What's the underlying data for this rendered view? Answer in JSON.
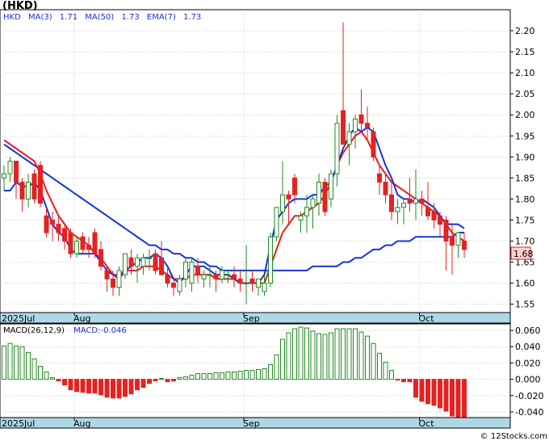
{
  "ticker_label": "(HKD)",
  "legend_main": {
    "symbol": "HKD",
    "ma3": "MA(3)",
    "ma3_value": "1.71",
    "ma50": "MA(50)",
    "ma50_value": "1.73",
    "ema7": "EMA(7)",
    "ema7_value": "1.73"
  },
  "legend_macd": {
    "params": "MACD(26,12,9)",
    "value": "MACD:-0.046"
  },
  "last_price_label": "1.68",
  "credit": "© 12Stocks.com",
  "colors": {
    "up_candle": "#228b22",
    "down_candle": "#e32222",
    "ma_blue": "#1535d6",
    "ema_red": "#ee1c1c",
    "axis_band": "#aed8e6",
    "grid": "#b0b0b0",
    "last_price_bg": "#fbd0d0"
  },
  "chart_data": [
    {
      "type": "candlestick",
      "ylim": [
        1.53,
        2.25
      ],
      "yticks": [
        1.55,
        1.6,
        1.65,
        1.7,
        1.75,
        1.8,
        1.85,
        1.9,
        1.95,
        2.0,
        2.05,
        2.1,
        2.15,
        2.2
      ],
      "xlabels": [
        {
          "text": "2025Jul",
          "i": 0
        },
        {
          "text": "Aug",
          "i": 12
        },
        {
          "text": "Sep",
          "i": 40
        },
        {
          "text": "Oct",
          "i": 69
        }
      ],
      "candles": [
        [
          1.85,
          1.88,
          1.82,
          1.86
        ],
        [
          1.86,
          1.9,
          1.84,
          1.89
        ],
        [
          1.89,
          1.88,
          1.8,
          1.84
        ],
        [
          1.84,
          1.85,
          1.77,
          1.8
        ],
        [
          1.8,
          1.86,
          1.78,
          1.84
        ],
        [
          1.86,
          1.87,
          1.79,
          1.8
        ],
        [
          1.88,
          1.89,
          1.78,
          1.79
        ],
        [
          1.76,
          1.78,
          1.71,
          1.72
        ],
        [
          1.75,
          1.77,
          1.7,
          1.74
        ],
        [
          1.74,
          1.76,
          1.7,
          1.72
        ],
        [
          1.73,
          1.74,
          1.68,
          1.7
        ],
        [
          1.72,
          1.73,
          1.66,
          1.67
        ],
        [
          1.67,
          1.71,
          1.66,
          1.7
        ],
        [
          1.71,
          1.72,
          1.67,
          1.68
        ],
        [
          1.69,
          1.71,
          1.66,
          1.68
        ],
        [
          1.72,
          1.73,
          1.66,
          1.67
        ],
        [
          1.68,
          1.7,
          1.63,
          1.64
        ],
        [
          1.63,
          1.64,
          1.58,
          1.61
        ],
        [
          1.61,
          1.63,
          1.57,
          1.59
        ],
        [
          1.59,
          1.64,
          1.57,
          1.63
        ],
        [
          1.62,
          1.67,
          1.61,
          1.67
        ],
        [
          1.66,
          1.68,
          1.62,
          1.64
        ],
        [
          1.64,
          1.67,
          1.6,
          1.66
        ],
        [
          1.64,
          1.67,
          1.62,
          1.66
        ],
        [
          1.66,
          1.68,
          1.63,
          1.66
        ],
        [
          1.67,
          1.68,
          1.62,
          1.63
        ],
        [
          1.66,
          1.7,
          1.64,
          1.62
        ],
        [
          1.62,
          1.64,
          1.59,
          1.6
        ],
        [
          1.6,
          1.61,
          1.57,
          1.59
        ],
        [
          1.58,
          1.62,
          1.57,
          1.61
        ],
        [
          1.61,
          1.66,
          1.59,
          1.65
        ],
        [
          1.6,
          1.66,
          1.58,
          1.65
        ],
        [
          1.64,
          1.66,
          1.6,
          1.62
        ],
        [
          1.61,
          1.63,
          1.59,
          1.62
        ],
        [
          1.62,
          1.64,
          1.59,
          1.62
        ],
        [
          1.62,
          1.63,
          1.58,
          1.61
        ],
        [
          1.61,
          1.64,
          1.6,
          1.63
        ],
        [
          1.62,
          1.63,
          1.6,
          1.62
        ],
        [
          1.62,
          1.64,
          1.59,
          1.61
        ],
        [
          1.61,
          1.63,
          1.58,
          1.6
        ],
        [
          1.6,
          1.69,
          1.55,
          1.6
        ],
        [
          1.61,
          1.63,
          1.58,
          1.6
        ],
        [
          1.59,
          1.61,
          1.57,
          1.61
        ],
        [
          1.58,
          1.62,
          1.57,
          1.6
        ],
        [
          1.6,
          1.72,
          1.59,
          1.71
        ],
        [
          1.71,
          1.78,
          1.7,
          1.78
        ],
        [
          1.77,
          1.89,
          1.74,
          1.81
        ],
        [
          1.81,
          1.82,
          1.74,
          1.8
        ],
        [
          1.85,
          1.86,
          1.79,
          1.81
        ],
        [
          1.75,
          1.77,
          1.72,
          1.76
        ],
        [
          1.76,
          1.81,
          1.72,
          1.78
        ],
        [
          1.78,
          1.81,
          1.73,
          1.8
        ],
        [
          1.79,
          1.86,
          1.76,
          1.84
        ],
        [
          1.84,
          1.85,
          1.76,
          1.77
        ],
        [
          1.8,
          1.87,
          1.78,
          1.86
        ],
        [
          1.86,
          2.0,
          1.83,
          1.98
        ],
        [
          2.01,
          2.22,
          1.94,
          1.93
        ],
        [
          1.93,
          1.98,
          1.88,
          1.96
        ],
        [
          1.96,
          2.0,
          1.92,
          1.99
        ],
        [
          2.0,
          2.06,
          1.96,
          1.98
        ],
        [
          1.98,
          2.02,
          1.94,
          1.97
        ],
        [
          1.96,
          1.97,
          1.89,
          1.9
        ],
        [
          1.86,
          1.88,
          1.81,
          1.84
        ],
        [
          1.84,
          1.86,
          1.79,
          1.81
        ],
        [
          1.81,
          1.84,
          1.75,
          1.77
        ],
        [
          1.77,
          1.8,
          1.74,
          1.78
        ],
        [
          1.78,
          1.8,
          1.74,
          1.79
        ],
        [
          1.8,
          1.85,
          1.77,
          1.79
        ],
        [
          1.79,
          1.87,
          1.75,
          1.8
        ],
        [
          1.8,
          1.82,
          1.76,
          1.79
        ],
        [
          1.78,
          1.84,
          1.75,
          1.76
        ],
        [
          1.77,
          1.79,
          1.73,
          1.75
        ],
        [
          1.76,
          1.77,
          1.71,
          1.74
        ],
        [
          1.75,
          1.76,
          1.63,
          1.7
        ],
        [
          1.71,
          1.74,
          1.62,
          1.69
        ],
        [
          1.69,
          1.72,
          1.66,
          1.72
        ],
        [
          1.7,
          1.72,
          1.66,
          1.68
        ]
      ],
      "ma3": [
        1.82,
        1.82,
        1.84,
        1.83,
        1.83,
        1.84,
        1.82,
        1.78,
        1.74,
        1.72,
        1.71,
        1.68,
        1.67,
        1.67,
        1.67,
        1.67,
        1.65,
        1.63,
        1.62,
        1.61,
        1.63,
        1.64,
        1.65,
        1.66,
        1.66,
        1.67,
        1.66,
        1.64,
        1.61,
        1.6,
        1.62,
        1.64,
        1.64,
        1.64,
        1.63,
        1.62,
        1.62,
        1.62,
        1.61,
        1.6,
        1.6,
        1.6,
        1.6,
        1.62,
        1.69,
        1.75,
        1.77,
        1.79,
        1.8,
        1.8,
        1.8,
        1.81,
        1.81,
        1.83,
        1.84,
        1.88,
        1.92,
        1.95,
        1.97,
        1.96,
        1.97,
        1.96,
        1.92,
        1.88,
        1.85,
        1.81,
        1.8,
        1.8,
        1.79,
        1.8,
        1.79,
        1.78,
        1.76,
        1.74,
        1.74,
        1.74,
        1.73
      ],
      "ema7": [
        1.94,
        1.93,
        1.92,
        1.91,
        1.9,
        1.89,
        1.86,
        1.82,
        1.79,
        1.76,
        1.74,
        1.72,
        1.71,
        1.7,
        1.69,
        1.67,
        1.66,
        1.64,
        1.62,
        1.62,
        1.63,
        1.63,
        1.63,
        1.64,
        1.64,
        1.64,
        1.63,
        1.62,
        1.61,
        1.61,
        1.61,
        1.62,
        1.62,
        1.62,
        1.62,
        1.61,
        1.61,
        1.61,
        1.61,
        1.6,
        1.6,
        1.6,
        1.6,
        1.6,
        1.64,
        1.68,
        1.72,
        1.74,
        1.76,
        1.76,
        1.77,
        1.78,
        1.79,
        1.81,
        1.84,
        1.88,
        1.91,
        1.93,
        1.95,
        1.96,
        1.94,
        1.91,
        1.88,
        1.86,
        1.84,
        1.83,
        1.82,
        1.81,
        1.8,
        1.79,
        1.78,
        1.77,
        1.76,
        1.74,
        1.72,
        1.71,
        1.7
      ],
      "ma50": [
        1.93,
        1.92,
        1.91,
        1.9,
        1.89,
        1.88,
        1.87,
        1.86,
        1.85,
        1.84,
        1.83,
        1.82,
        1.81,
        1.8,
        1.79,
        1.78,
        1.77,
        1.76,
        1.75,
        1.74,
        1.73,
        1.72,
        1.71,
        1.7,
        1.69,
        1.69,
        1.68,
        1.68,
        1.67,
        1.67,
        1.66,
        1.66,
        1.65,
        1.65,
        1.64,
        1.64,
        1.63,
        1.63,
        1.63,
        1.63,
        1.63,
        1.63,
        1.63,
        1.63,
        1.63,
        1.63,
        1.63,
        1.63,
        1.63,
        1.63,
        1.63,
        1.64,
        1.64,
        1.64,
        1.64,
        1.64,
        1.65,
        1.65,
        1.66,
        1.66,
        1.67,
        1.68,
        1.68,
        1.69,
        1.69,
        1.7,
        1.7,
        1.7,
        1.71,
        1.71,
        1.71,
        1.71,
        1.71,
        1.71,
        1.71,
        1.72,
        1.72
      ]
    },
    {
      "type": "bar",
      "name": "MACD(26,12,9)",
      "ylim": [
        -0.047,
        0.068
      ],
      "yticks": [
        0.06,
        0.04,
        0.02,
        0.0,
        -0.02,
        -0.04
      ],
      "ytick_labels": [
        "0.060",
        "0.040",
        "0.020",
        "0.000",
        "-0.020",
        "-0.040"
      ],
      "xlabels": [
        {
          "text": "2025Jul",
          "i": 0
        },
        {
          "text": "Aug",
          "i": 12
        },
        {
          "text": "Sep",
          "i": 40
        },
        {
          "text": "Oct",
          "i": 69
        }
      ],
      "values": [
        0.041,
        0.044,
        0.041,
        0.04,
        0.033,
        0.025,
        0.016,
        0.009,
        0.002,
        -0.002,
        -0.007,
        -0.013,
        -0.015,
        -0.016,
        -0.017,
        -0.017,
        -0.019,
        -0.022,
        -0.023,
        -0.023,
        -0.021,
        -0.018,
        -0.013,
        -0.01,
        -0.005,
        -0.002,
        0.001,
        -0.003,
        -0.002,
        0.002,
        0.003,
        0.005,
        0.007,
        0.007,
        0.007,
        0.008,
        0.008,
        0.009,
        0.009,
        0.01,
        0.011,
        0.011,
        0.012,
        0.013,
        0.018,
        0.03,
        0.049,
        0.057,
        0.062,
        0.064,
        0.063,
        0.059,
        0.056,
        0.055,
        0.057,
        0.062,
        0.062,
        0.062,
        0.062,
        0.058,
        0.053,
        0.044,
        0.032,
        0.021,
        0.011,
        -0.001,
        -0.003,
        -0.003,
        -0.022,
        -0.027,
        -0.03,
        -0.032,
        -0.035,
        -0.039,
        -0.045,
        -0.046,
        -0.046
      ]
    }
  ]
}
